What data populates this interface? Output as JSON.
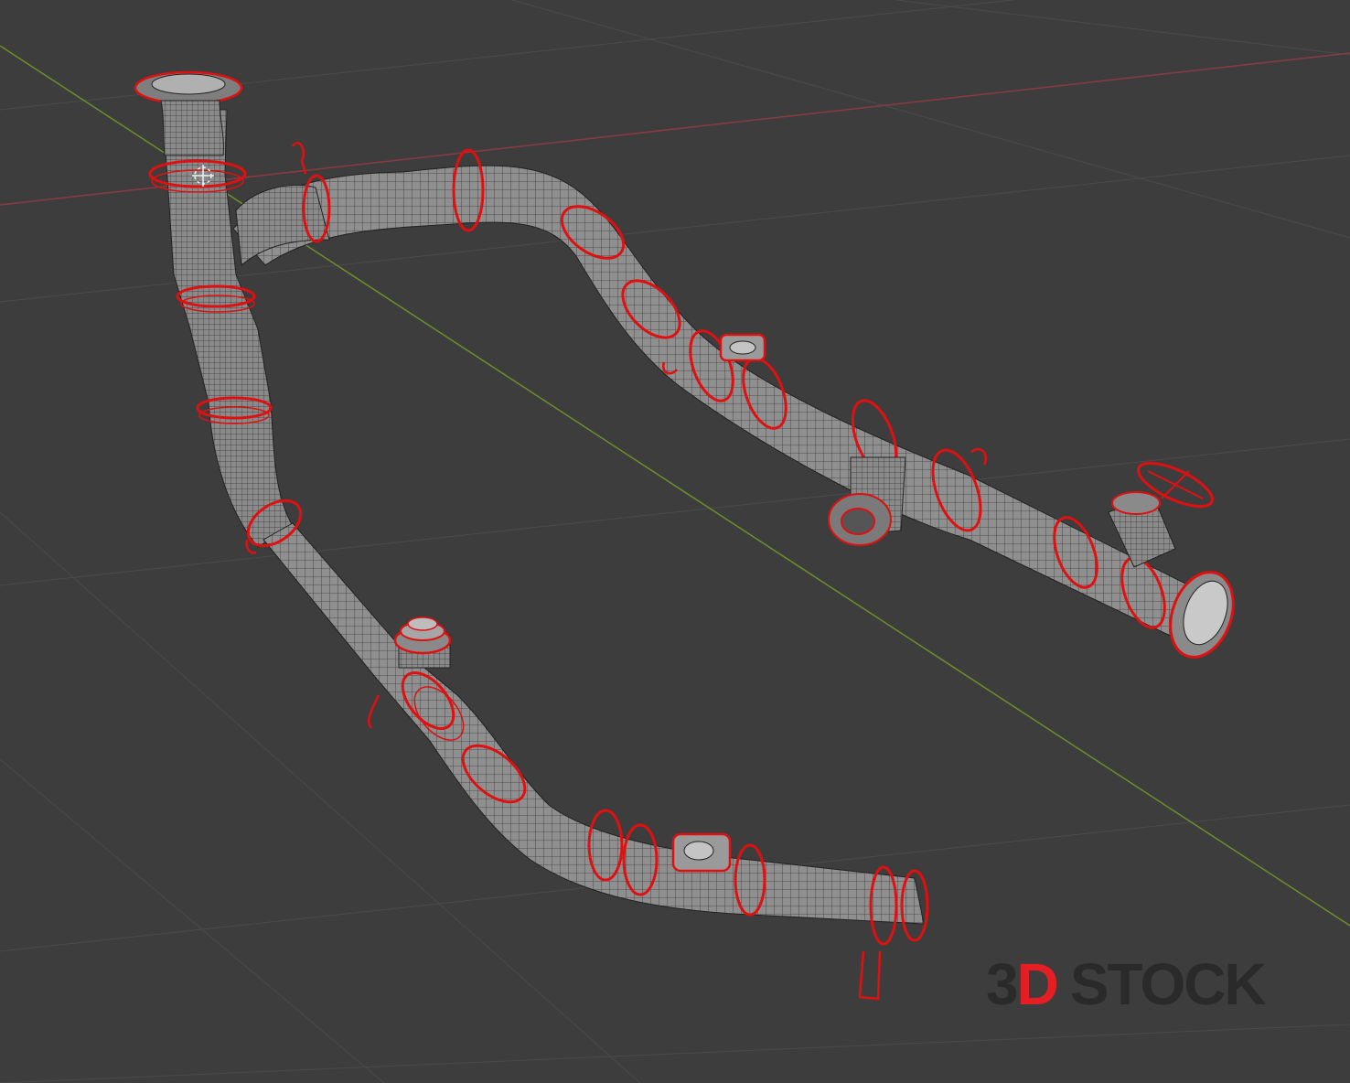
{
  "viewport": {
    "background": "#3d3d3d",
    "grid_color": "#4a4a4a",
    "x_axis_color": "#8a3b42",
    "y_axis_color": "#6b8f2a",
    "mesh_fill": "#8c8c8c",
    "wire_color": "#2a2a2a",
    "edge_highlight_color": "#e01010"
  },
  "watermark": {
    "part_3": "3",
    "part_d": "D",
    "part_stock": "STOCK",
    "accent": "#e51e24",
    "dark": "#2a2a2a"
  }
}
